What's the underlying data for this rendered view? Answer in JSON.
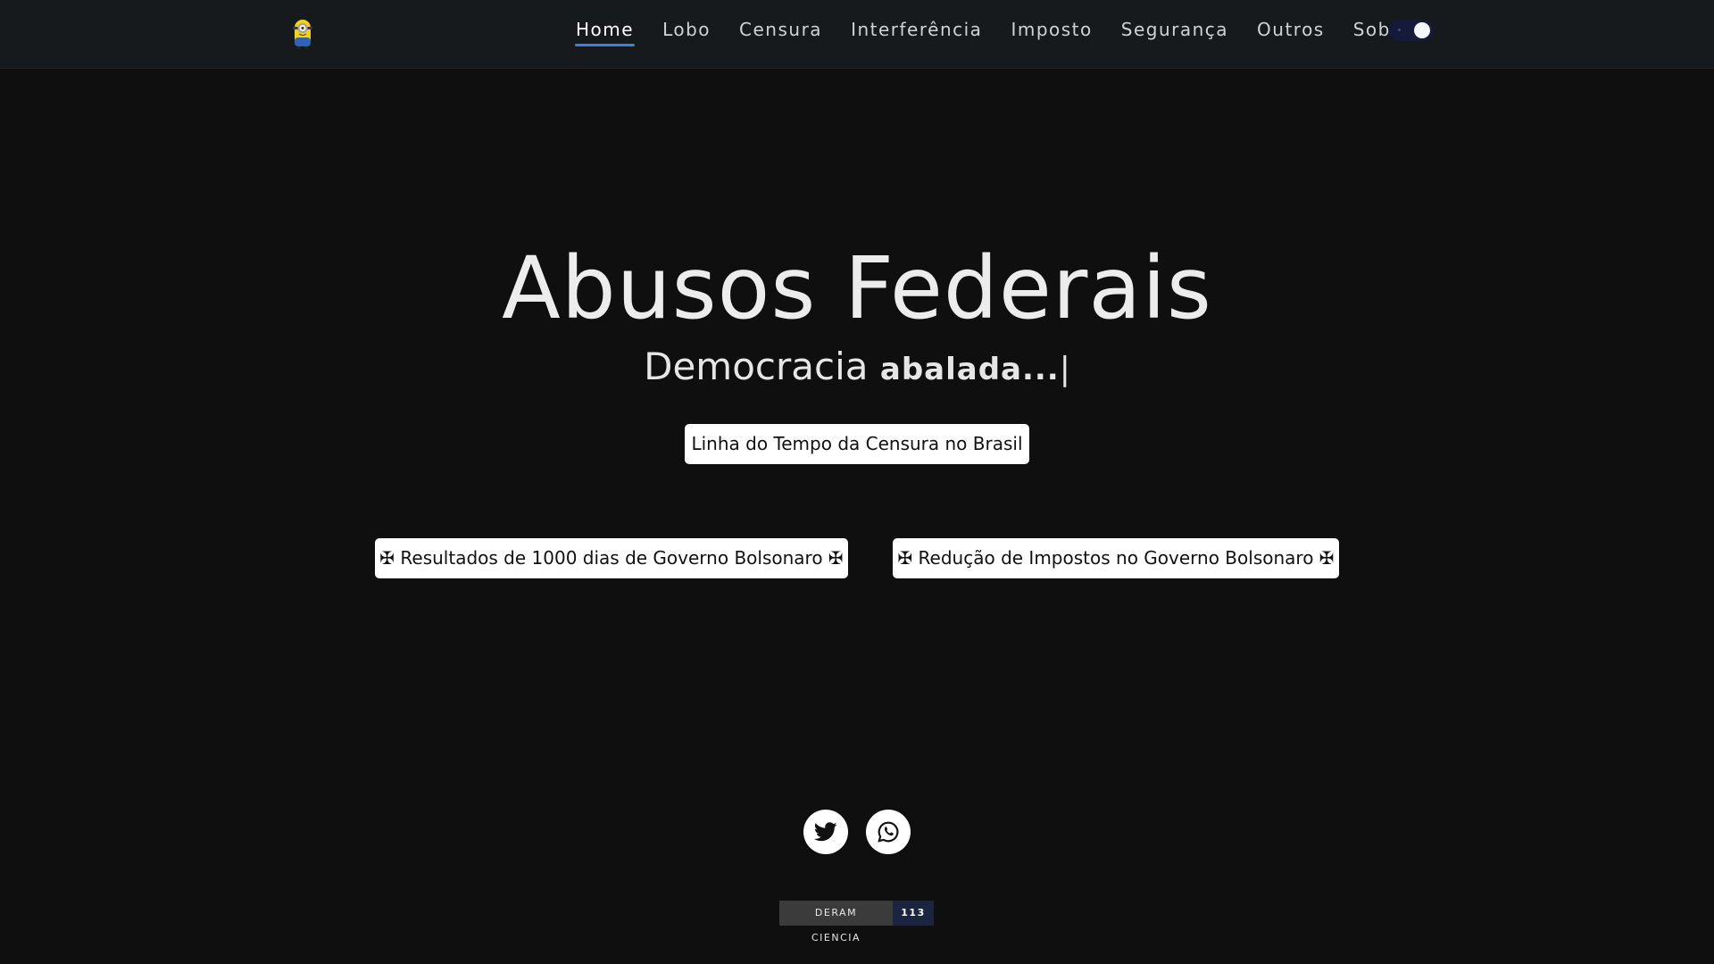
{
  "nav": {
    "logo_icon": "minion-icon",
    "items": [
      {
        "label": "Home",
        "active": true
      },
      {
        "label": "Lobo"
      },
      {
        "label": "Censura"
      },
      {
        "label": "Interferência"
      },
      {
        "label": "Imposto"
      },
      {
        "label": "Segurança"
      },
      {
        "label": "Outros"
      },
      {
        "label": "Sobre"
      }
    ],
    "theme_toggle_state": "dark"
  },
  "hero": {
    "title": "Abusos Federais",
    "subtitle_static": "Democracia",
    "subtitle_typed": "abalada...",
    "subtitle_cursor": "|",
    "timeline_button": "Linha do Tempo da Censura no Brasil"
  },
  "links": {
    "results_button": "✠ Resultados de 1000 dias de Governo Bolsonaro ✠",
    "taxes_button": "✠ Redução de Impostos no Governo Bolsonaro ✠"
  },
  "social": {
    "icons": [
      "twitter-icon",
      "whatsapp-icon"
    ]
  },
  "badge": {
    "label": "DERAM CIENCIA",
    "count": "113"
  },
  "colors": {
    "background": "#0f0f0f",
    "navbar": "#171a1d",
    "accent": "#3f7fd6",
    "badge_label_bg": "#3b3b3b",
    "badge_count_bg": "#1c2540"
  }
}
